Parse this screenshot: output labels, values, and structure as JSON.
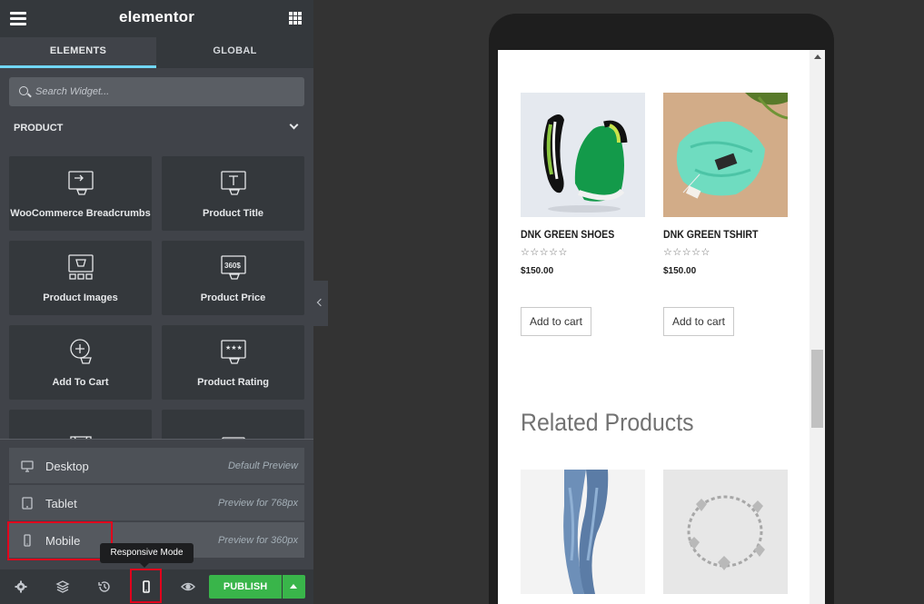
{
  "topbar": {
    "brand": "elementor"
  },
  "tabs": {
    "elements": "ELEMENTS",
    "global": "GLOBAL"
  },
  "search": {
    "placeholder": "Search Widget..."
  },
  "category": {
    "label": "PRODUCT"
  },
  "widgets": [
    {
      "label": "WooCommerce Breadcrumbs",
      "icon": "breadcrumbs-icon"
    },
    {
      "label": "Product Title",
      "icon": "product-title-icon"
    },
    {
      "label": "Product Images",
      "icon": "product-images-icon"
    },
    {
      "label": "Product Price",
      "icon": "product-price-icon"
    },
    {
      "label": "Add To Cart",
      "icon": "add-to-cart-icon"
    },
    {
      "label": "Product Rating",
      "icon": "product-rating-icon"
    }
  ],
  "responsive": [
    {
      "name": "Desktop",
      "desc": "Default Preview",
      "icon": "desktop-icon"
    },
    {
      "name": "Tablet",
      "desc": "Preview for 768px",
      "icon": "tablet-icon"
    },
    {
      "name": "Mobile",
      "desc": "Preview for 360px",
      "icon": "mobile-icon"
    }
  ],
  "tooltip": {
    "text": "Responsive Mode"
  },
  "bottombar": {
    "publish": "PUBLISH"
  },
  "preview": {
    "products": [
      {
        "title": "DNK GREEN SHOES",
        "price": "$150.00",
        "cart": "Add to cart",
        "stars": "☆☆☆☆☆"
      },
      {
        "title": "DNK GREEN TSHIRT",
        "price": "$150.00",
        "cart": "Add to cart",
        "stars": "☆☆☆☆☆"
      }
    ],
    "related_heading": "Related Products"
  },
  "colors": {
    "accent": "#71d7f7",
    "publish": "#39b54a",
    "highlight": "#e1001c"
  }
}
